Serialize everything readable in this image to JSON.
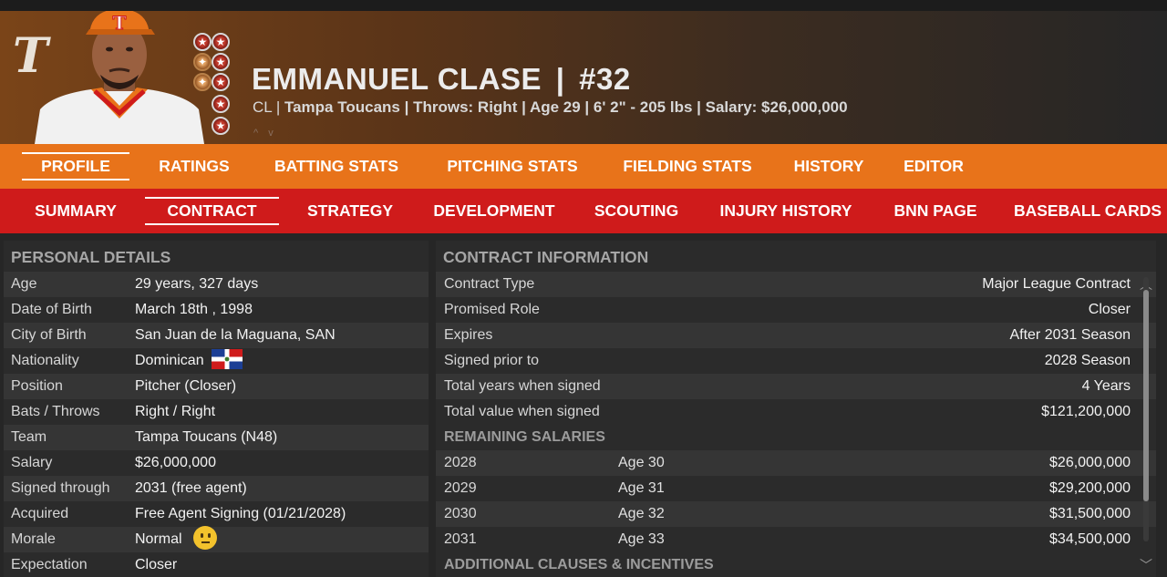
{
  "header": {
    "team_logo": "T",
    "player_name": "EMMANUEL CLASE",
    "separator": "|",
    "number": "#32",
    "position": "CL",
    "team": "Tampa Toucans",
    "throws": "Throws: Right",
    "age": "Age 29",
    "height": "6' 2\"",
    "weight": "- 205 lbs",
    "salary": "Salary: $26,000,000",
    "cap_letter": "T",
    "medals": [
      "star",
      "star",
      "bronze",
      "star",
      "bronze",
      "star",
      "star",
      "star"
    ]
  },
  "main_tabs": [
    "PROFILE",
    "RATINGS",
    "BATTING STATS",
    "PITCHING STATS",
    "FIELDING STATS",
    "HISTORY",
    "EDITOR"
  ],
  "sub_tabs": [
    "SUMMARY",
    "CONTRACT",
    "STRATEGY",
    "DEVELOPMENT",
    "SCOUTING",
    "INJURY HISTORY",
    "BNN PAGE",
    "BASEBALL CARDS"
  ],
  "personal": {
    "title": "PERSONAL DETAILS",
    "rows": [
      {
        "k": "Age",
        "v": "29 years, 327 days"
      },
      {
        "k": "Date of Birth",
        "v": "March 18th , 1998"
      },
      {
        "k": "City of Birth",
        "v": "San Juan de la Maguana, SAN"
      },
      {
        "k": "Nationality",
        "v": "Dominican"
      },
      {
        "k": "Position",
        "v": "Pitcher (Closer)"
      },
      {
        "k": "Bats / Throws",
        "v": "Right / Right"
      },
      {
        "k": "Team",
        "v": "Tampa Toucans (N48)"
      },
      {
        "k": "Salary",
        "v": "$26,000,000"
      },
      {
        "k": "Signed through",
        "v": "2031 (free agent)"
      },
      {
        "k": "Acquired",
        "v": "Free Agent Signing (01/21/2028)"
      },
      {
        "k": "Morale",
        "v": "Normal"
      },
      {
        "k": "Expectation",
        "v": "Closer"
      }
    ]
  },
  "contract": {
    "title": "CONTRACT INFORMATION",
    "rows": [
      {
        "k": "Contract Type",
        "v": "Major League Contract"
      },
      {
        "k": "Promised Role",
        "v": "Closer"
      },
      {
        "k": "Expires",
        "v": "After 2031 Season"
      },
      {
        "k": "Signed prior to",
        "v": "2028 Season"
      },
      {
        "k": "Total years when signed",
        "v": "4 Years"
      },
      {
        "k": "Total value when signed",
        "v": "$121,200,000"
      }
    ],
    "remaining_title": "REMAINING SALARIES",
    "salaries": [
      {
        "year": "2028",
        "age": "Age 30",
        "amount": "$26,000,000"
      },
      {
        "year": "2029",
        "age": "Age 31",
        "amount": "$29,200,000"
      },
      {
        "year": "2030",
        "age": "Age 32",
        "amount": "$31,500,000"
      },
      {
        "year": "2031",
        "age": "Age 33",
        "amount": "$34,500,000"
      }
    ],
    "clauses_title": "ADDITIONAL CLAUSES & INCENTIVES"
  }
}
